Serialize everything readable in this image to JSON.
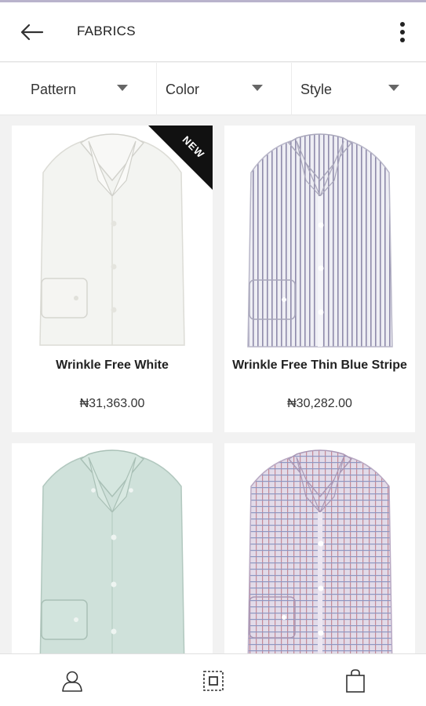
{
  "header": {
    "title": "FABRICS",
    "back_icon": "arrow-left-icon",
    "menu_icon": "more-vertical-icon"
  },
  "filters": [
    {
      "label": "Pattern"
    },
    {
      "label": "Color"
    },
    {
      "label": "Style"
    }
  ],
  "products": [
    {
      "name": "Wrinkle Free White",
      "price": "₦31,363.00",
      "badge": "NEW",
      "color": "#f4f5f2",
      "stripe": "none"
    },
    {
      "name": "Wrinkle Free Thin Blue Stripe",
      "price": "₦30,282.00",
      "badge": "",
      "color": "#e8e8f0",
      "stripe": "#8a86a8"
    },
    {
      "name": "",
      "price": "",
      "badge": "",
      "color": "#cde0d9",
      "stripe": "none"
    },
    {
      "name": "",
      "price": "",
      "badge": "",
      "color": "#ddd6e6",
      "stripe": "#c07f8c"
    }
  ],
  "bottom_nav": [
    {
      "icon": "user-icon"
    },
    {
      "icon": "fabric-select-icon"
    },
    {
      "icon": "shopping-bag-icon"
    }
  ],
  "colors": {
    "badge": "#111111",
    "accent_line": "#b9b3cc"
  }
}
